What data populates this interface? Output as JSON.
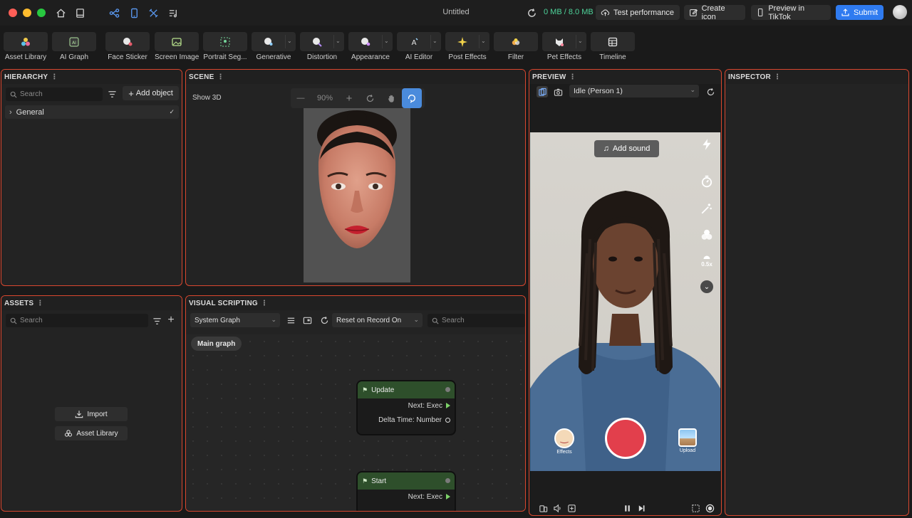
{
  "window": {
    "title": "Untitled",
    "memory": "0 MB / 8.0 MB"
  },
  "titlebar_buttons": {
    "test_performance": "Test performance",
    "create_icon": "Create icon",
    "preview_tiktok": "Preview in TikTok",
    "submit": "Submit"
  },
  "toolbar": [
    {
      "label": "Asset Library",
      "icon": "asset-library-icon"
    },
    {
      "label": "AI Graph",
      "icon": "ai-graph-icon"
    },
    {
      "label": "Face Sticker",
      "icon": "face-sticker-icon"
    },
    {
      "label": "Screen Image",
      "icon": "screen-image-icon"
    },
    {
      "label": "Portrait Seg...",
      "icon": "portrait-seg-icon"
    },
    {
      "label": "Generative",
      "icon": "generative-icon"
    },
    {
      "label": "Distortion",
      "icon": "distortion-icon"
    },
    {
      "label": "Appearance",
      "icon": "appearance-icon"
    },
    {
      "label": "AI Editor",
      "icon": "ai-editor-icon"
    },
    {
      "label": "Post Effects",
      "icon": "post-effects-icon"
    },
    {
      "label": "Filter",
      "icon": "filter-icon"
    },
    {
      "label": "Pet Effects",
      "icon": "pet-effects-icon"
    },
    {
      "label": "Timeline",
      "icon": "timeline-icon"
    }
  ],
  "hierarchy": {
    "title": "HIERARCHY",
    "search_placeholder": "Search",
    "add_object": "Add object",
    "items": [
      {
        "label": "General"
      }
    ]
  },
  "scene": {
    "title": "SCENE",
    "show3d": "Show 3D",
    "zoom": "90%"
  },
  "assets": {
    "title": "ASSETS",
    "search_placeholder": "Search",
    "import": "Import",
    "asset_library": "Asset Library"
  },
  "visual_scripting": {
    "title": "VISUAL SCRIPTING",
    "graph_select": "System Graph",
    "reset_select": "Reset on Record On",
    "search_placeholder": "Search",
    "tab": "Main graph",
    "nodes": [
      {
        "title": "Update",
        "outputs": [
          "Next: Exec",
          "Delta Time: Number"
        ]
      },
      {
        "title": "Start",
        "outputs": [
          "Next: Exec"
        ]
      }
    ]
  },
  "preview": {
    "title": "PREVIEW",
    "state_select": "Idle (Person 1)",
    "add_sound": "Add sound",
    "speed": "0.5x",
    "effects": "Effects",
    "upload": "Upload"
  },
  "inspector": {
    "title": "INSPECTOR"
  },
  "colors": {
    "panel_border": "#d9472f",
    "accent": "#2f7bf0",
    "memory": "#4ed39a",
    "record": "#e23f4c",
    "node_header": "#2e4f2b"
  }
}
